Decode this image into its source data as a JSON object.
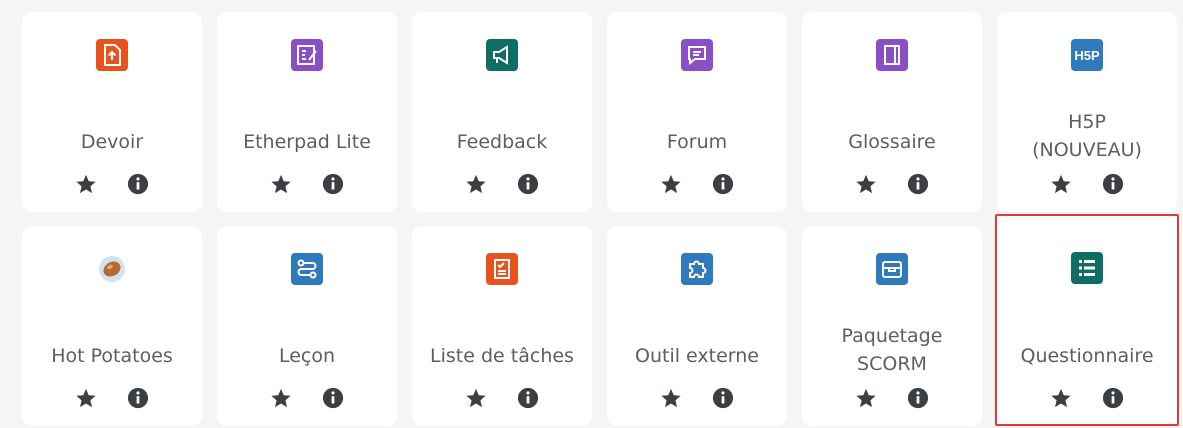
{
  "modules": [
    {
      "label": "Devoir",
      "icon": "assignment-icon",
      "color": "#e8531d"
    },
    {
      "label": "Etherpad Lite",
      "icon": "etherpad-icon",
      "color": "#8a4fc4"
    },
    {
      "label": "Feedback",
      "icon": "megaphone-icon",
      "color": "#0f6e63"
    },
    {
      "label": "Forum",
      "icon": "chat-bubble-icon",
      "color": "#8a4fc4"
    },
    {
      "label": "Glossaire",
      "icon": "book-icon",
      "color": "#8a4fc4"
    },
    {
      "label": "H5P\n(NOUVEAU)",
      "icon": "h5p-icon",
      "color": "#2f79bd",
      "icon_text": "H5P"
    },
    {
      "label": "Hot Potatoes",
      "icon": "hot-potatoes-icon",
      "color": "#d98a4a"
    },
    {
      "label": "Leçon",
      "icon": "lesson-path-icon",
      "color": "#2f79bd"
    },
    {
      "label": "Liste de tâches",
      "icon": "checklist-icon",
      "color": "#e8531d"
    },
    {
      "label": "Outil externe",
      "icon": "puzzle-icon",
      "color": "#2f79bd"
    },
    {
      "label": "Paquetage\nSCORM",
      "icon": "package-icon",
      "color": "#2f79bd"
    },
    {
      "label": "Questionnaire",
      "icon": "list-icon",
      "color": "#0f6e63",
      "selected": true
    }
  ],
  "star_icon": "star-icon",
  "info_icon": "info-icon"
}
